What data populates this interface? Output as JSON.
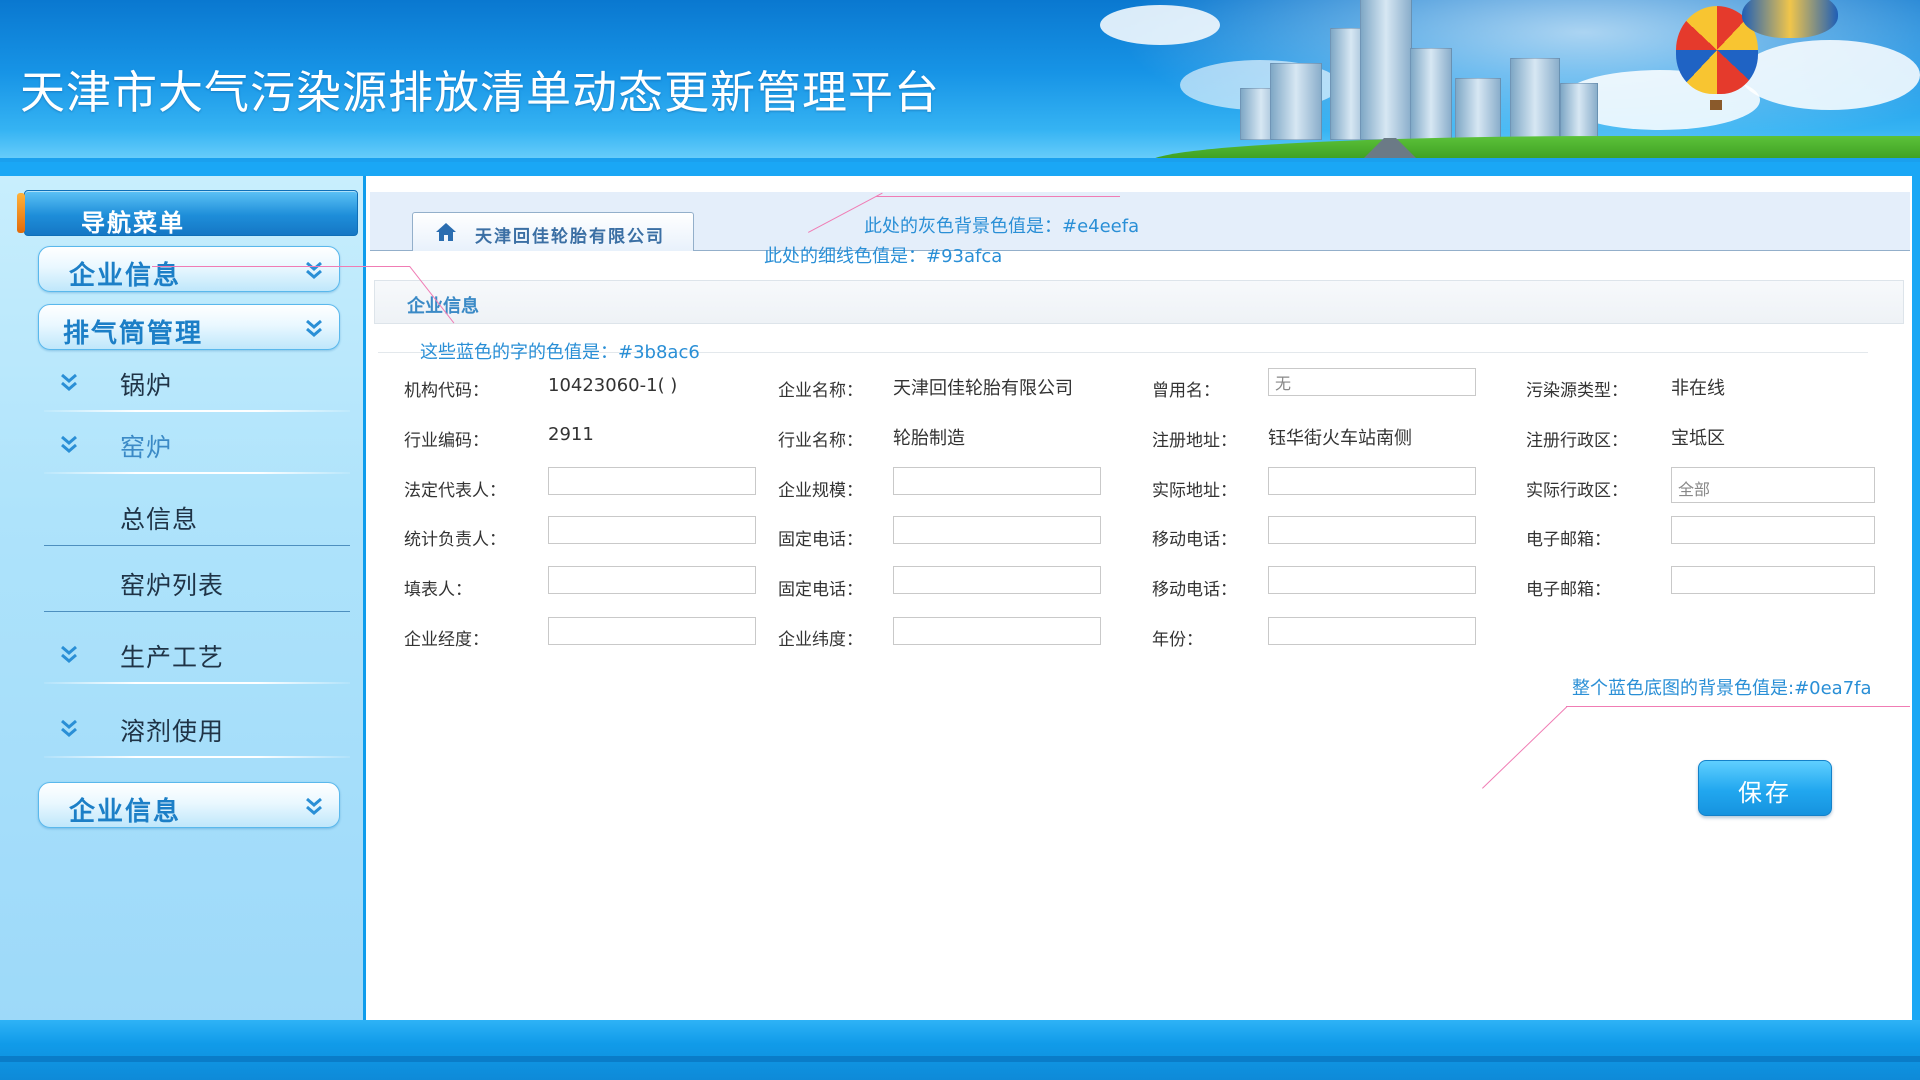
{
  "app": {
    "title": "天津市大气污染源排放清单动态更新管理平台"
  },
  "sidebar": {
    "header": "导航菜单",
    "groups": [
      {
        "label": "企业信息"
      },
      {
        "label": "排气筒管理"
      }
    ],
    "items": [
      {
        "label": "锅炉"
      },
      {
        "label": "窑炉"
      },
      {
        "label": "总信息"
      },
      {
        "label": "窑炉列表"
      },
      {
        "label": "生产工艺"
      },
      {
        "label": "溶剂使用"
      }
    ],
    "bottom_group": {
      "label": "企业信息"
    }
  },
  "tab": {
    "label": "天津回佳轮胎有限公司"
  },
  "section": {
    "title": "企业信息"
  },
  "form": {
    "org_code": {
      "label": "机构代码：",
      "value": "10423060-1( )"
    },
    "company_name": {
      "label": "企业名称：",
      "value": "天津回佳轮胎有限公司"
    },
    "former_name": {
      "label": "曾用名：",
      "value": "无"
    },
    "pollution_type": {
      "label": "污染源类型：",
      "value": "非在线"
    },
    "industry_code": {
      "label": "行业编码：",
      "value": "2911"
    },
    "industry_name": {
      "label": "行业名称：",
      "value": "轮胎制造"
    },
    "reg_address": {
      "label": "注册地址：",
      "value": "钰华街火车站南侧"
    },
    "reg_district": {
      "label": "注册行政区：",
      "value": "宝坻区"
    },
    "legal_rep": {
      "label": "法定代表人：",
      "value": ""
    },
    "scale": {
      "label": "企业规模：",
      "value": ""
    },
    "actual_address": {
      "label": "实际地址：",
      "value": ""
    },
    "actual_district": {
      "label": "实际行政区：",
      "value": "全部"
    },
    "stat_person": {
      "label": "统计负责人：",
      "value": ""
    },
    "phone1": {
      "label": "固定电话：",
      "value": ""
    },
    "mobile1": {
      "label": "移动电话：",
      "value": ""
    },
    "email1": {
      "label": "电子邮箱：",
      "value": ""
    },
    "filler": {
      "label": "填表人：",
      "value": ""
    },
    "phone2": {
      "label": "固定电话：",
      "value": ""
    },
    "mobile2": {
      "label": "移动电话：",
      "value": ""
    },
    "email2": {
      "label": "电子邮箱：",
      "value": ""
    },
    "longitude": {
      "label": "企业经度：",
      "value": ""
    },
    "latitude": {
      "label": "企业纬度：",
      "value": ""
    },
    "year": {
      "label": "年份：",
      "value": ""
    }
  },
  "save_label": "保存",
  "annotations": {
    "gray_bg": "此处的灰色背景色值是：#e4eefa",
    "thin_line": "此处的细线色值是：#93afca",
    "blue_text": "这些蓝色的字的色值是：#3b8ac6",
    "blue_bg": "整个蓝色底图的背景色值是:#0ea7fa"
  },
  "colors": {
    "page_bg": "#0ea7fa",
    "tab_bar_bg": "#e4eefa",
    "thin_line": "#93afca",
    "blue_text": "#3b8ac6"
  },
  "icons": {
    "home": "home-icon",
    "chevron": "double-chevron-down-icon"
  }
}
